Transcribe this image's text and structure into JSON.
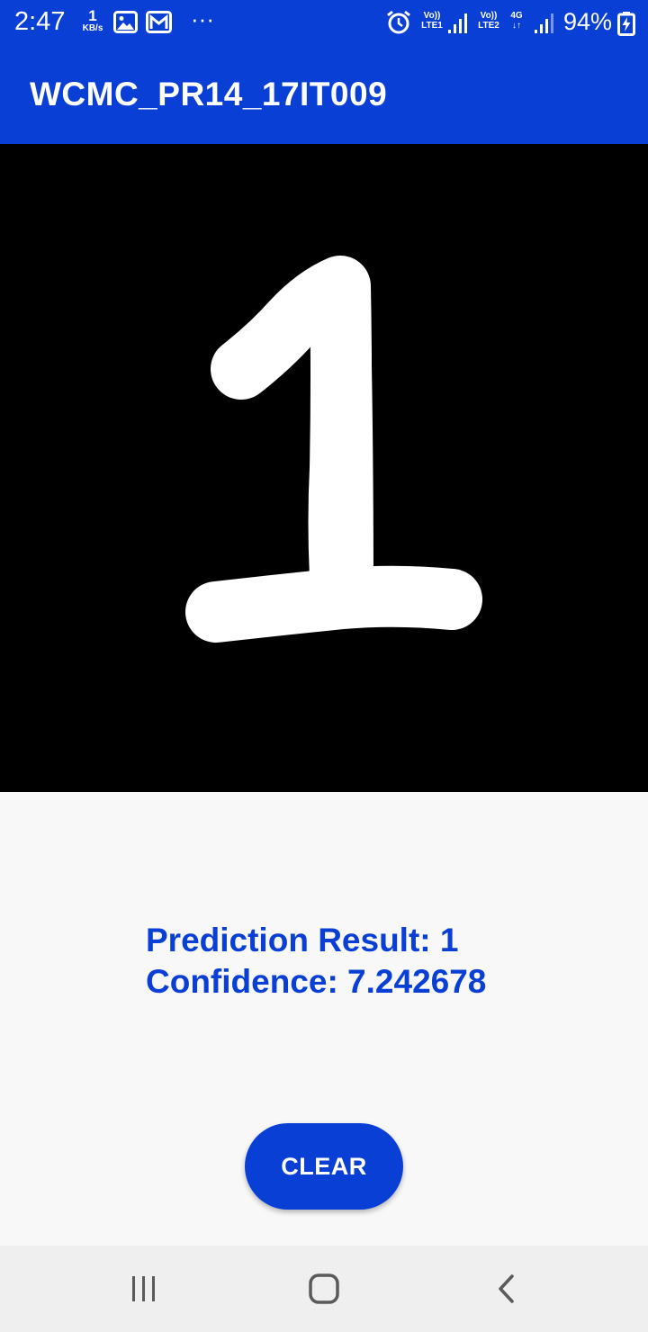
{
  "status_bar": {
    "time": "2:47",
    "speed_value": "1",
    "speed_unit": "KB/s",
    "overflow": "···",
    "sim1_label_top": "Vo))",
    "sim1_label_bottom": "LTE1",
    "sim2_label_top": "Vo))",
    "sim2_label_bottom": "LTE2",
    "network_type": "4G",
    "battery_percent": "94%",
    "icons": [
      "gallery-icon",
      "gmail-icon",
      "alarm-icon",
      "signal-icon",
      "battery-charging-icon"
    ]
  },
  "app_bar": {
    "title": "WCMC_PR14_17IT009"
  },
  "result": {
    "prediction_line": "Prediction Result: 1",
    "confidence_line": "Confidence: 7.242678"
  },
  "clear_button": {
    "label": "CLEAR"
  },
  "nav_bar": {
    "icons": [
      "recents-icon",
      "home-icon",
      "back-icon"
    ]
  },
  "colors": {
    "primary": "#0a3fd6",
    "canvas": "#000000",
    "stroke": "#ffffff",
    "background": "#f8f8f8"
  }
}
